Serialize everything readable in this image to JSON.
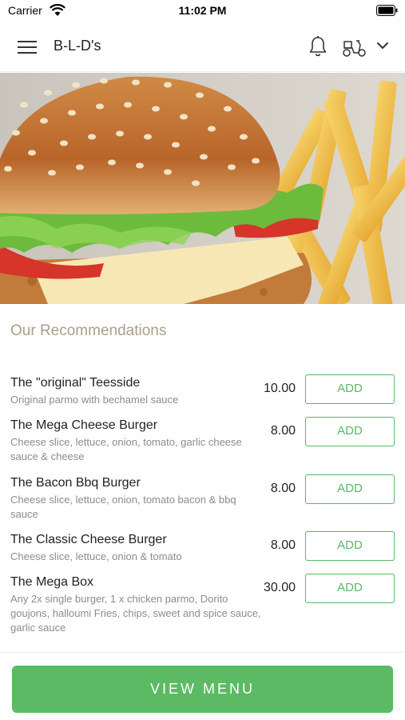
{
  "status": {
    "carrier": "Carrier",
    "time": "11:02 PM"
  },
  "header": {
    "title": "B-L-D's"
  },
  "section_title": "Our Recommendations",
  "items": [
    {
      "name": "The \"original\" Teesside",
      "desc": "Original parmo with bechamel sauce",
      "price": "10.00",
      "add": "ADD"
    },
    {
      "name": "The Mega Cheese Burger",
      "desc": "Cheese slice, lettuce, onion, tomato, garlic cheese sauce & cheese",
      "price": "8.00",
      "add": "ADD"
    },
    {
      "name": "The Bacon Bbq Burger",
      "desc": "Cheese slice, lettuce, onion, tomato bacon & bbq sauce",
      "price": "8.00",
      "add": "ADD"
    },
    {
      "name": "The Classic Cheese Burger",
      "desc": "Cheese slice, lettuce, onion & tomato",
      "price": "8.00",
      "add": "ADD"
    },
    {
      "name": "The Mega Box",
      "desc": "Any 2x single burger, 1 x chicken parmo, Dorito goujons, halloumi Fries, chips, sweet and spice sauce, garlic sauce",
      "price": "30.00",
      "add": "ADD"
    }
  ],
  "footer": {
    "view_menu": "VIEW MENU"
  },
  "colors": {
    "accent": "#5cba65",
    "section_title": "#a8a08a"
  }
}
